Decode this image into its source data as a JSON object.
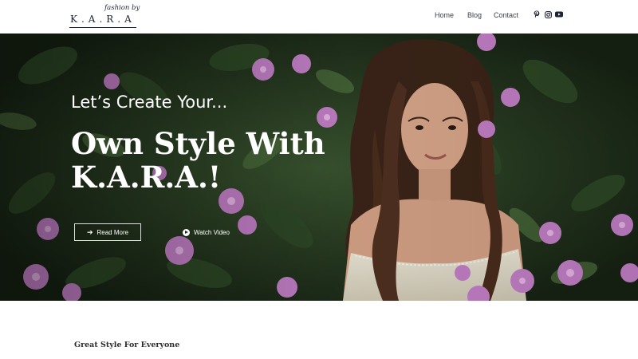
{
  "brand": {
    "tagline": "fashion by",
    "name": "K.A.R.A"
  },
  "nav": {
    "items": [
      {
        "label": "Home"
      },
      {
        "label": "Blog"
      },
      {
        "label": "Contact"
      }
    ]
  },
  "social": {
    "icons": [
      "pinterest-icon",
      "instagram-icon",
      "youtube-icon"
    ]
  },
  "hero": {
    "kicker": "Let’s Create Your...",
    "heading_line1": "Own Style With",
    "heading_line2": "K.A.R.A.!",
    "read_more_label": "Read More",
    "read_more_icon": "arrow-right-icon",
    "watch_video_label": "Watch Video",
    "watch_video_icon": "play-circle-icon"
  },
  "section": {
    "title": "Great Style For Everyone"
  },
  "colors": {
    "brand_navy": "#1e2236",
    "nav_text": "#3a3d4a",
    "foliage_dark": "#1c2a1a",
    "flower_purple": "#c27fc6"
  }
}
